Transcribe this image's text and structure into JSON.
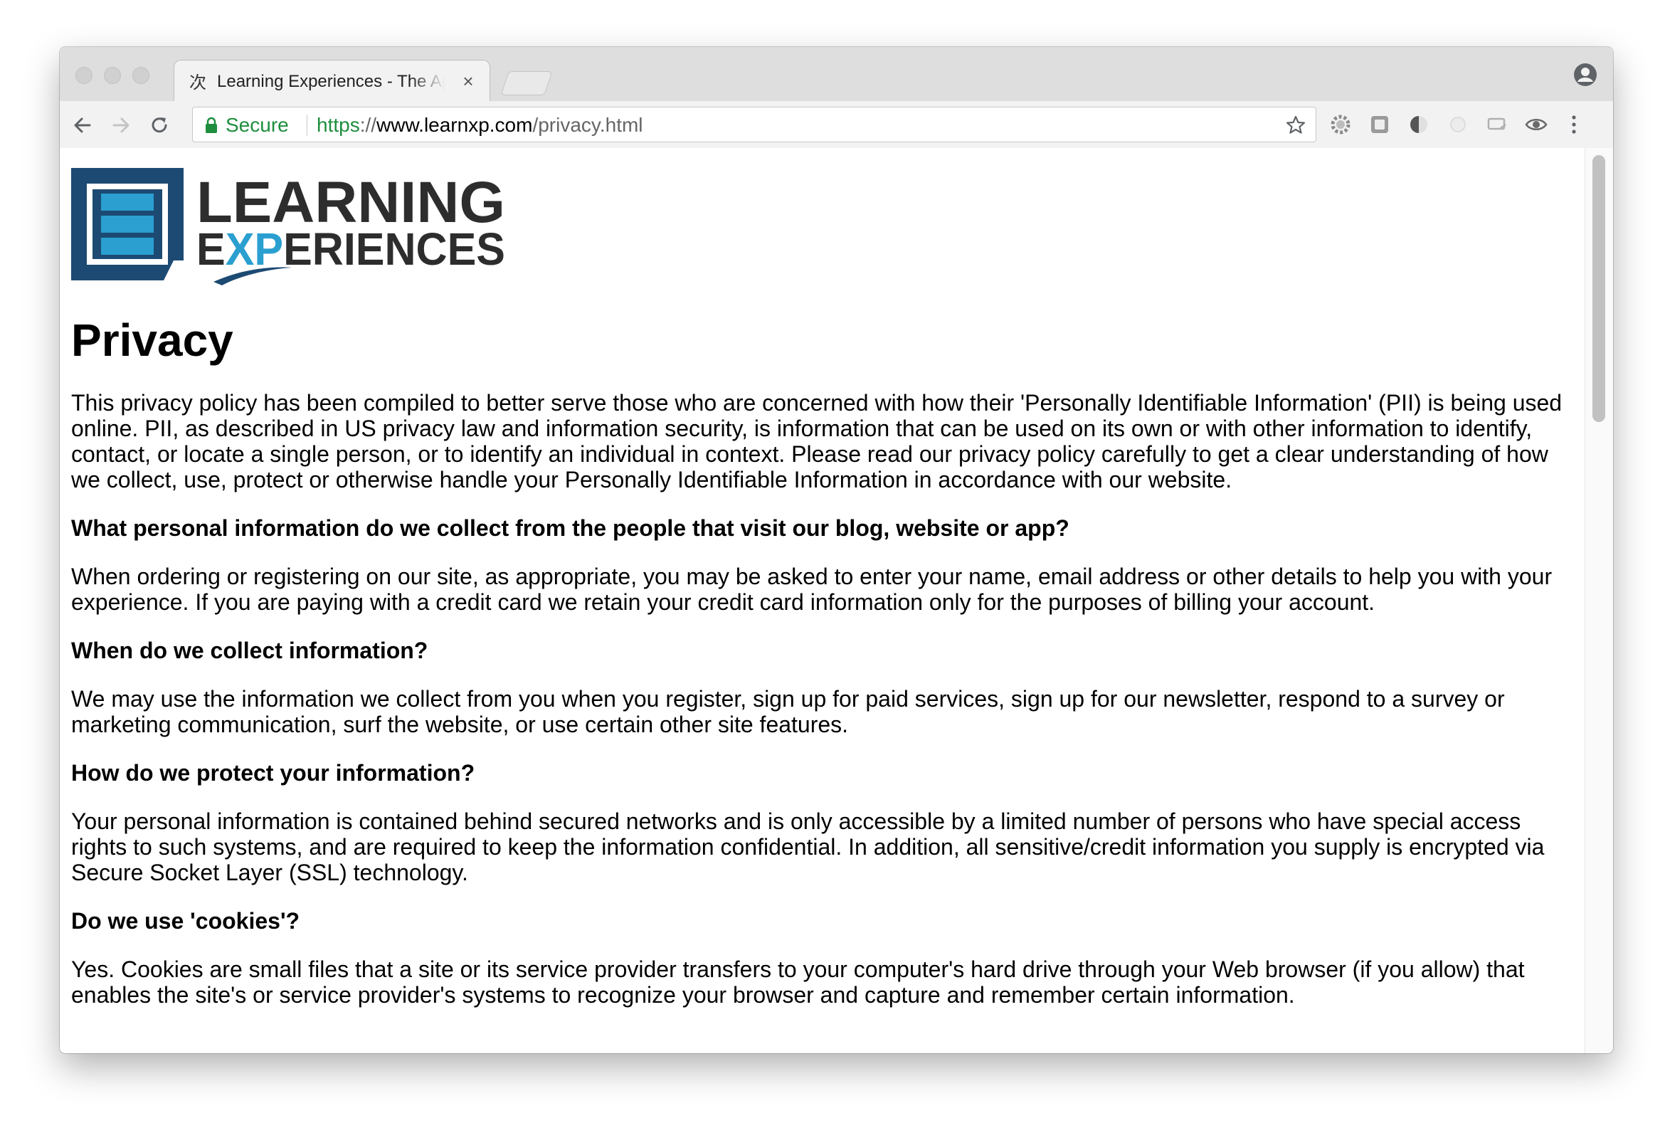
{
  "browser": {
    "tab": {
      "title": "Learning Experiences - The App",
      "close_glyph": "×"
    },
    "omnibox": {
      "security_label": "Secure",
      "url_scheme": "https",
      "url_separator": "://",
      "url_host": "www.learnxp.com",
      "url_path": "/privacy.html"
    },
    "toolbar_icons": [
      "back-arrow-icon",
      "forward-arrow-icon",
      "reload-icon",
      "lock-icon",
      "star-icon",
      "gear-extension-icon",
      "square-extension-icon",
      "half-circle-extension-icon",
      "faded-circle-extension-icon",
      "cast-extension-icon",
      "eye-extension-icon",
      "kebab-menu-icon",
      "profile-icon"
    ],
    "colors": {
      "secure_green": "#1e8e3e",
      "tabstrip": "#dedede",
      "toolbar": "#f2f2f2"
    }
  },
  "logo": {
    "line1": "LEARNING",
    "line2_part1": "E",
    "line2_highlight": "XP",
    "line2_part2": "ERIENCES",
    "colors": {
      "navy": "#1c4a72",
      "cyan": "#2a9fd0",
      "text": "#2d2d2d"
    }
  },
  "page": {
    "title": "Privacy",
    "intro": "This privacy policy has been compiled to better serve those who are concerned with how their 'Personally Identifiable Information' (PII) is being used online. PII, as described in US privacy law and information security, is information that can be used on its own or with other information to identify, contact, or locate a single person, or to identify an individual in context. Please read our privacy policy carefully to get a clear understanding of how we collect, use, protect or otherwise handle your Personally Identifiable Information in accordance with our website.",
    "sections": [
      {
        "heading": "What personal information do we collect from the people that visit our blog, website or app?",
        "body": "When ordering or registering on our site, as appropriate, you may be asked to enter your name, email address or other details to help you with your experience. If you are paying with a credit card we retain your credit card information only for the purposes of billing your account."
      },
      {
        "heading": "When do we collect information?",
        "body": "We may use the information we collect from you when you register, sign up for paid services, sign up for our newsletter, respond to a survey or marketing communication, surf the website, or use certain other site features."
      },
      {
        "heading": "How do we protect your information?",
        "body": "Your personal information is contained behind secured networks and is only accessible by a limited number of persons who have special access rights to such systems, and are required to keep the information confidential. In addition, all sensitive/credit information you supply is encrypted via Secure Socket Layer (SSL) technology."
      },
      {
        "heading": "Do we use 'cookies'?",
        "body": "Yes. Cookies are small files that a site or its service provider transfers to your computer's hard drive through your Web browser (if you allow) that enables the site's or service provider's systems to recognize your browser and capture and remember certain information."
      }
    ]
  }
}
